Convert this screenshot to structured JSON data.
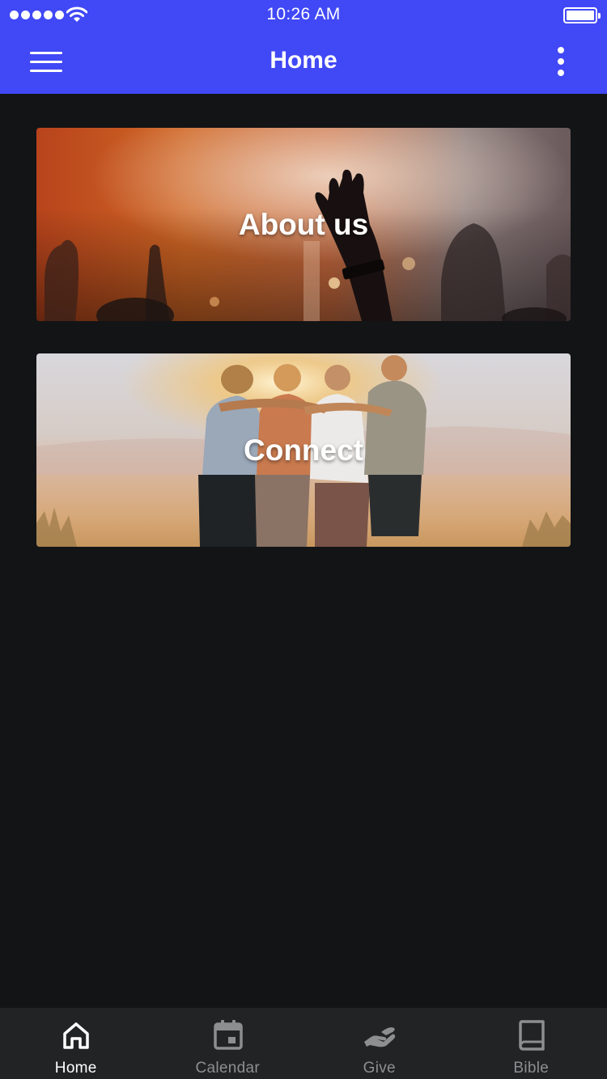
{
  "status_bar": {
    "time": "10:26 AM",
    "signal_icon": "signal-dots-icon",
    "wifi_icon": "wifi-icon",
    "battery_icon": "battery-full-icon",
    "battery_level": 1.0
  },
  "app_bar": {
    "title": "Home",
    "menu_icon": "hamburger-menu-icon",
    "more_icon": "more-vertical-icon",
    "background": "#4148f5"
  },
  "cards": [
    {
      "label": "About us",
      "image": "concert-crowd-raised-hands-photo"
    },
    {
      "label": "Connect",
      "image": "friends-embracing-sunset-photo"
    }
  ],
  "tabs": [
    {
      "label": "Home",
      "icon": "home-icon",
      "active": true
    },
    {
      "label": "Calendar",
      "icon": "calendar-icon",
      "active": false
    },
    {
      "label": "Give",
      "icon": "give-hand-icon",
      "active": false
    },
    {
      "label": "Bible",
      "icon": "book-icon",
      "active": false
    }
  ],
  "colors": {
    "accent": "#4148f5",
    "background": "#131416",
    "tab_bar": "#222325",
    "tab_active": "#ffffff",
    "tab_inactive": "#8d8e90"
  }
}
